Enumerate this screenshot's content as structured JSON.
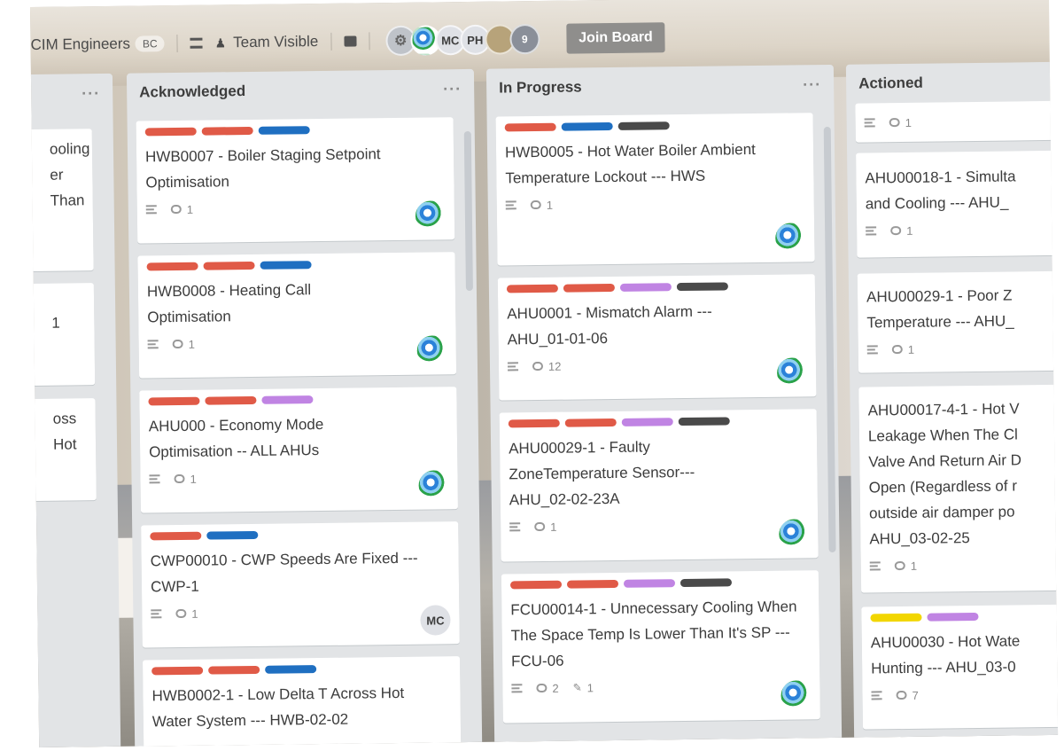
{
  "colors": {
    "red": "#e05a47",
    "blue": "#1f6fc1",
    "purple": "#c084e3",
    "dark": "#4a4a4a",
    "yellow": "#f2d600"
  },
  "header": {
    "team_name": "CIM Engineers",
    "team_badge": "BC",
    "visibility": "Team Visible",
    "avatars": [
      "MC",
      "PH"
    ],
    "avatar_count": "9",
    "join_label": "Join Board"
  },
  "lists": [
    {
      "name": "",
      "cards": [
        {
          "title_lines": [
            "ooling",
            "er Than"
          ],
          "comments": ""
        },
        {
          "title_lines": [
            "1"
          ],
          "comments": ""
        },
        {
          "title_lines": [
            "oss Hot"
          ],
          "comments": ""
        }
      ]
    },
    {
      "name": "Acknowledged",
      "menu": "···",
      "cards": [
        {
          "labels": [
            "red",
            "red",
            "blue"
          ],
          "title": "HWB0007 - Boiler Staging Setpoint Optimisation",
          "comments": "1",
          "avatar": "logo"
        },
        {
          "labels": [
            "red",
            "red",
            "blue"
          ],
          "title": "HWB0008 - Heating Call Optimisation",
          "comments": "1",
          "avatar": "logo"
        },
        {
          "labels": [
            "red",
            "red",
            "purple"
          ],
          "title": "AHU000 - Economy Mode Optimisation -- ALL AHUs",
          "comments": "1",
          "avatar": "logo"
        },
        {
          "labels": [
            "red",
            "blue"
          ],
          "title": "CWP00010 - CWP Speeds Are Fixed --- CWP-1",
          "comments": "1",
          "avatar": "MC"
        },
        {
          "labels": [
            "red",
            "red",
            "blue"
          ],
          "title": "HWB0002-1 - Low Delta T Across Hot Water System --- HWB-02-02",
          "comments": "",
          "avatar": ""
        }
      ]
    },
    {
      "name": "In Progress",
      "menu": "···",
      "cards": [
        {
          "labels": [
            "red",
            "blue",
            "dark"
          ],
          "title": "HWB0005 - Hot Water Boiler Ambient Temperature Lockout --- HWS",
          "comments": "1",
          "avatar": "logo"
        },
        {
          "labels": [
            "red",
            "red",
            "purple",
            "dark"
          ],
          "title": "AHU0001 - Mismatch Alarm --- AHU_01-01-06",
          "comments": "12",
          "avatar": "logo"
        },
        {
          "labels": [
            "red",
            "red",
            "purple",
            "dark"
          ],
          "title": "AHU00029-1 - Faulty ZoneTemperature Sensor--- AHU_02-02-23A",
          "comments": "1",
          "avatar": "logo"
        },
        {
          "labels": [
            "red",
            "red",
            "purple",
            "dark"
          ],
          "title": "FCU00014-1 - Unnecessary Cooling When The Space Temp Is Lower Than It's SP --- FCU-06",
          "comments": "2",
          "attachments": "1",
          "avatar": "logo"
        }
      ]
    },
    {
      "name": "Actioned",
      "cards": [
        {
          "labels": [],
          "title": "",
          "comments": "1"
        },
        {
          "labels": [],
          "title_lines": [
            "AHU00018-1 - Simulta",
            "and Cooling --- AHU_"
          ],
          "comments": "1"
        },
        {
          "labels": [],
          "title_lines": [
            "AHU00029-1 - Poor Z",
            "Temperature --- AHU_"
          ],
          "comments": "1"
        },
        {
          "labels": [],
          "title_lines": [
            "AHU00017-4-1 - Hot V",
            "Leakage When The Cl",
            "Valve And Return Air D",
            "Open (Regardless of r",
            "outside air damper po",
            "AHU_03-02-25"
          ],
          "comments": "1"
        },
        {
          "labels": [
            "yellow",
            "purple"
          ],
          "title_lines": [
            "AHU00030 - Hot Wate",
            "Hunting --- AHU_03-0"
          ],
          "comments": "7"
        }
      ]
    }
  ]
}
